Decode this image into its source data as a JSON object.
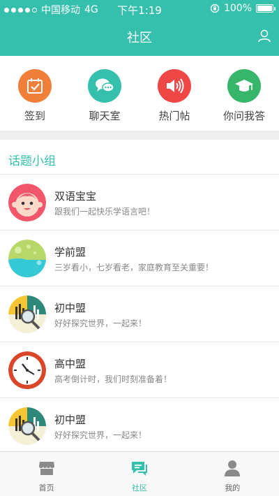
{
  "status": {
    "carrier": "中国移动",
    "network": "4G",
    "time": "下午1:19",
    "battery": "100%"
  },
  "header": {
    "title": "社区"
  },
  "quick_actions": [
    {
      "label": "签到",
      "icon": "calendar-check-icon",
      "color": "#f07f3a"
    },
    {
      "label": "聊天室",
      "icon": "chat-bubbles-icon",
      "color": "#35c0ad"
    },
    {
      "label": "热门帖",
      "icon": "speaker-icon",
      "color": "#ef4646"
    },
    {
      "label": "你问我答",
      "icon": "graduation-cap-icon",
      "color": "#36b56b"
    }
  ],
  "section": {
    "title": "话题小组"
  },
  "groups": [
    {
      "name": "双语宝宝",
      "desc": "跟我们一起快乐学语言吧！",
      "icon": "baby-face-icon"
    },
    {
      "name": "学前盟",
      "desc": "三岁看小，七岁看老，家庭教育至关重要！",
      "icon": "bubbles-icon"
    },
    {
      "name": "初中盟",
      "desc": "好好探究世界，一起来！",
      "icon": "magnifier-chart-icon"
    },
    {
      "name": "高中盟",
      "desc": "高考倒计时，我们时刻准备着！",
      "icon": "clock-icon"
    },
    {
      "name": "初中盟",
      "desc": "好好探究世界，一起来！",
      "icon": "magnifier-chart-icon"
    }
  ],
  "tabs": [
    {
      "label": "首页",
      "icon": "store-icon",
      "active": false
    },
    {
      "label": "社区",
      "icon": "chat-icon",
      "active": true
    },
    {
      "label": "我的",
      "icon": "person-icon",
      "active": false
    }
  ],
  "colors": {
    "accent": "#35c0ad"
  }
}
